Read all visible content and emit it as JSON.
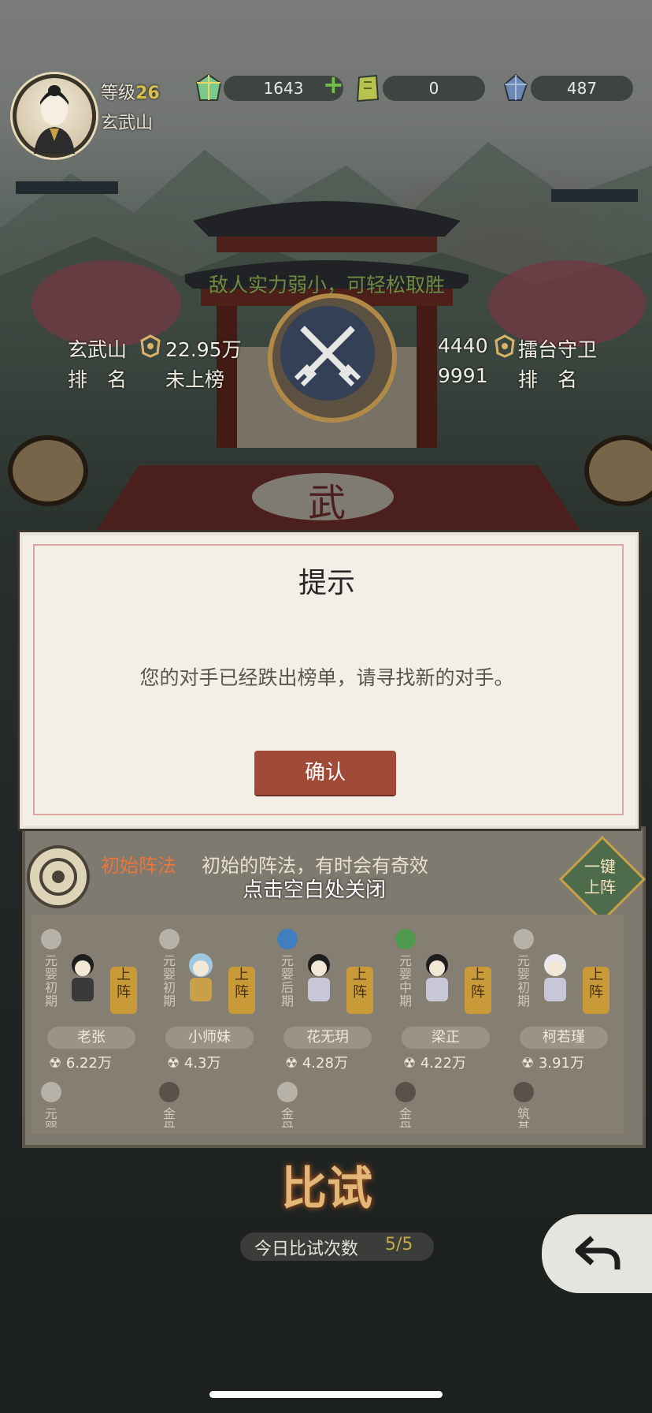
{
  "player": {
    "level_label": "等级",
    "level_value": "26",
    "name": "玄武山"
  },
  "resources": {
    "jade": "1643",
    "token": "0",
    "crystal": "487",
    "add_symbol": "+"
  },
  "battle": {
    "hint": "敌人实力弱小，可轻松取胜",
    "player_name": "玄武山",
    "player_power": "22.95万",
    "player_rank_label": "排　名",
    "player_rank_value": "未上榜",
    "enemy_power": "4440",
    "enemy_name": "擂台守卫",
    "enemy_rank_value": "9991",
    "enemy_rank_label": "排　名",
    "arena_char": "武"
  },
  "dialog": {
    "title": "提示",
    "message": "您的对手已经跌出榜单，请寻找新的对手。",
    "confirm_label": "确认",
    "dismiss_hint": "点击空白处关闭"
  },
  "formation": {
    "name": "初始阵法",
    "desc": "初始的阵法，有时会有奇效",
    "auto_deploy": "一键上阵",
    "deploy_label": "上阵",
    "cards": [
      {
        "realm": "元婴初期",
        "name": "老张",
        "power": "6.22万"
      },
      {
        "realm": "元婴初期",
        "name": "小师妹",
        "power": "4.3万"
      },
      {
        "realm": "元婴后期",
        "name": "花无玥",
        "power": "4.28万"
      },
      {
        "realm": "元婴中期",
        "name": "梁正",
        "power": "4.22万"
      },
      {
        "realm": "元婴初期",
        "name": "柯若瑾",
        "power": "3.91万"
      }
    ],
    "row2_realms": [
      "元婴",
      "金丹",
      "金丹",
      "金丹",
      "筑基"
    ]
  },
  "bottom": {
    "fight_label": "比试",
    "count_label": "今日比试次数",
    "count_value": "5/5"
  },
  "colors": {
    "dialog_bg": "#f3efe6",
    "confirm_button": "#a24a38",
    "gold_text": "#c4a94a",
    "formation_name": "#e8763a"
  },
  "icons": [
    "jade-icon",
    "token-icon",
    "crystal-icon",
    "crossed-swords-icon",
    "power-icon",
    "formation-emblem-icon",
    "back-arrow-icon"
  ]
}
